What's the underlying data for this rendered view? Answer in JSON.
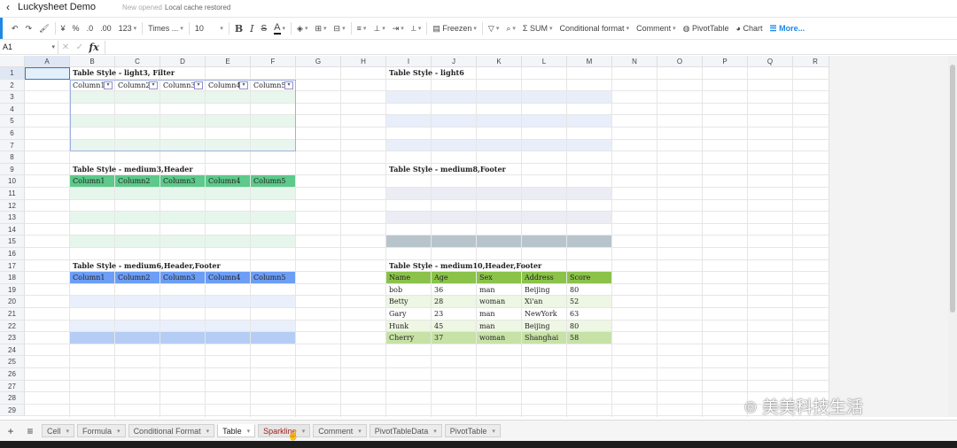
{
  "window": {
    "back_icon": "chevron-left-icon",
    "title": "Luckysheet Demo",
    "status_prefix": "New opened",
    "status_text": "Local cache restored"
  },
  "toolbar": {
    "accent_color": "#1e88e5",
    "currency": "¥",
    "percent": "%",
    "dec_decrease": ".0",
    "dec_increase": ".00",
    "number_format": "123",
    "font_family": "Times ...",
    "font_size": "10",
    "bold": "B",
    "italic": "I",
    "strikethrough": "S",
    "text_color": "A",
    "freeze": "Freezen",
    "sum": "SUM",
    "conditional_format": "Conditional format",
    "comment": "Comment",
    "pivot": "PivotTable",
    "chart": "Chart",
    "more": "More..."
  },
  "formula_bar": {
    "cell_ref": "A1",
    "fx": "fx"
  },
  "columns": [
    "A",
    "B",
    "C",
    "D",
    "E",
    "F",
    "G",
    "H",
    "I",
    "J",
    "K",
    "L",
    "M",
    "N",
    "O",
    "P",
    "Q",
    "R"
  ],
  "selected_column": "A",
  "rows": [
    "1",
    "2",
    "3",
    "4",
    "5",
    "6",
    "7",
    "8",
    "9",
    "10",
    "11",
    "12",
    "13",
    "14",
    "15",
    "16",
    "17",
    "18",
    "19",
    "20",
    "21",
    "22",
    "23",
    "24",
    "25",
    "26",
    "27",
    "28",
    "29"
  ],
  "selected_row": "1",
  "tables": {
    "t1": {
      "title": "Table Style - light3, Filter",
      "headers": [
        "Column1",
        "Column2",
        "Column3",
        "Column4",
        "Column5"
      ],
      "band_color": "#e9f6ee"
    },
    "t2": {
      "title": "Table Style - light6",
      "band_color": "#e8eefa"
    },
    "t3": {
      "title": "Table Style - medium3,Header",
      "headers": [
        "Column1",
        "Column2",
        "Column3",
        "Column4",
        "Column5"
      ],
      "header_color": "#5dc98a",
      "band_color": "#e6f6ec"
    },
    "t4": {
      "title": "Table Style - medium8,Footer",
      "band_color": "#ececf5",
      "footer_color": "#b8c4cc"
    },
    "t5": {
      "title": "Table Style - medium6,Header,Footer",
      "headers": [
        "Column1",
        "Column2",
        "Column3",
        "Column4",
        "Column5"
      ],
      "header_color": "#6d9ef5",
      "band_color": "#eaf0fb",
      "footer_color": "#b5cdf4"
    },
    "t6": {
      "title": "Table Style - medium10,Header,Footer",
      "headers": [
        "Name",
        "Age",
        "Sex",
        "Address",
        "Score"
      ],
      "rows": [
        [
          "bob",
          "36",
          "man",
          "Beijing",
          "80"
        ],
        [
          "Betty",
          "28",
          "woman",
          "Xi'an",
          "52"
        ],
        [
          "Gary",
          "23",
          "man",
          "NewYork",
          "63"
        ],
        [
          "Hunk",
          "45",
          "man",
          "Beijing",
          "80"
        ],
        [
          "Cherry",
          "37",
          "woman",
          "Shanghai",
          "58"
        ]
      ],
      "header_color": "#8bc34a",
      "band_color": "#eef6e4",
      "footer_color": "#c6e2a6"
    }
  },
  "watermark": {
    "icon": "wechat-icon",
    "text": "美美科技生活"
  },
  "sheet_tabs": [
    "Cell",
    "Formula",
    "Conditional Format",
    "Table",
    "Sparkline",
    "Comment",
    "PivotTableData",
    "PivotTable"
  ],
  "active_tab": "Table",
  "hover_tab": "Sparkline"
}
